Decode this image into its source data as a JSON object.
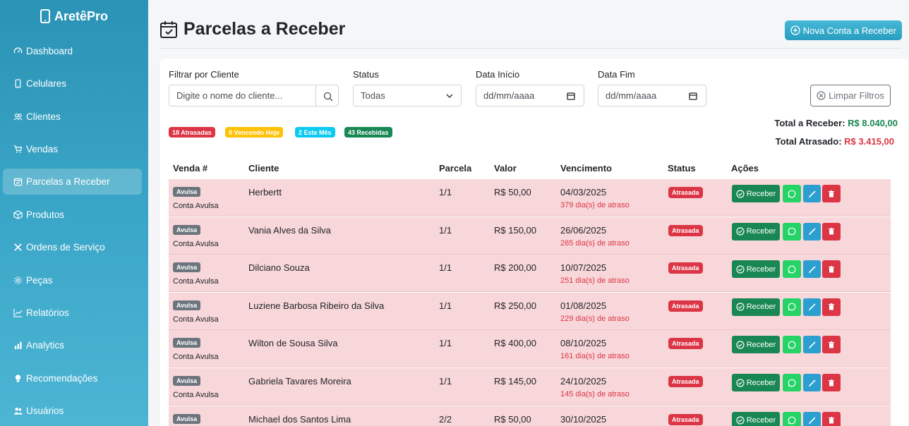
{
  "app": {
    "brand": "AretêPro"
  },
  "sidebar": {
    "items": [
      {
        "label": "Dashboard",
        "icon": "speedometer-icon"
      },
      {
        "label": "Celulares",
        "icon": "phone-icon"
      },
      {
        "label": "Clientes",
        "icon": "people-icon"
      },
      {
        "label": "Vendas",
        "icon": "cart-icon"
      },
      {
        "label": "Parcelas a Receber",
        "icon": "calendar-check-icon",
        "active": true
      },
      {
        "label": "Produtos",
        "icon": "box-icon"
      },
      {
        "label": "Ordens de Serviço",
        "icon": "tools-icon"
      },
      {
        "label": "Peças",
        "icon": "gear-icon"
      },
      {
        "label": "Relatórios",
        "icon": "graph-icon"
      },
      {
        "label": "Analytics",
        "icon": "bar-chart-icon"
      },
      {
        "label": "Recomendações",
        "icon": "lightbulb-icon"
      },
      {
        "label": "Usuários",
        "icon": "users-icon"
      }
    ]
  },
  "header": {
    "title": "Parcelas a Receber",
    "new_button": "Nova Conta a Receber"
  },
  "filters": {
    "client_label": "Filtrar por Cliente",
    "client_placeholder": "Digite o nome do cliente...",
    "status_label": "Status",
    "status_value": "Todas",
    "start_label": "Data Início",
    "start_value": "dd/mm/aaaa",
    "end_label": "Data Fim",
    "end_value": "dd/mm/aaaa",
    "clear_button": "Limpar Filtros"
  },
  "badges": [
    {
      "label": "18 Atrasadas",
      "color": "#dc3545"
    },
    {
      "label": "0 Vencendo Hoje",
      "color": "#ffc107"
    },
    {
      "label": "2 Este Mês",
      "color": "#0dcaf0"
    },
    {
      "label": "43 Recebidas",
      "color": "#198754"
    }
  ],
  "totals": {
    "receber_label": "Total a Receber:",
    "receber_value": "R$ 8.040,00",
    "atrasado_label": "Total Atrasado:",
    "atrasado_value": "R$ 3.415,00"
  },
  "table": {
    "headers": [
      "Venda #",
      "Cliente",
      "Parcela",
      "Valor",
      "Vencimento",
      "Status",
      "Ações"
    ],
    "receive_label": "Receber",
    "rows": [
      {
        "tag": "Avulsa",
        "type": "Conta Avulsa",
        "client": "Herbertt",
        "parcela": "1/1",
        "valor": "R$ 50,00",
        "vencimento": "04/03/2025",
        "atraso": "379 dia(s) de atraso",
        "status": "Atrasada"
      },
      {
        "tag": "Avulsa",
        "type": "Conta Avulsa",
        "client": "Vania Alves da Silva",
        "parcela": "1/1",
        "valor": "R$ 150,00",
        "vencimento": "26/06/2025",
        "atraso": "265 dia(s) de atraso",
        "status": "Atrasada"
      },
      {
        "tag": "Avulsa",
        "type": "Conta Avulsa",
        "client": "Dilciano Souza",
        "parcela": "1/1",
        "valor": "R$ 200,00",
        "vencimento": "10/07/2025",
        "atraso": "251 dia(s) de atraso",
        "status": "Atrasada"
      },
      {
        "tag": "Avulsa",
        "type": "Conta Avulsa",
        "client": "Luziene Barbosa Ribeiro da Silva",
        "parcela": "1/1",
        "valor": "R$ 250,00",
        "vencimento": "01/08/2025",
        "atraso": "229 dia(s) de atraso",
        "status": "Atrasada"
      },
      {
        "tag": "Avulsa",
        "type": "Conta Avulsa",
        "client": "Wilton de Sousa Silva",
        "parcela": "1/1",
        "valor": "R$ 400,00",
        "vencimento": "08/10/2025",
        "atraso": "161 dia(s) de atraso",
        "status": "Atrasada"
      },
      {
        "tag": "Avulsa",
        "type": "Conta Avulsa",
        "client": "Gabriela Tavares Moreira",
        "parcela": "1/1",
        "valor": "R$ 145,00",
        "vencimento": "24/10/2025",
        "atraso": "145 dia(s) de atraso",
        "status": "Atrasada"
      },
      {
        "tag": "Avulsa",
        "type": "",
        "client": "Michael dos Santos Lima",
        "parcela": "2/2",
        "valor": "R$ 50,00",
        "vencimento": "30/10/2025",
        "atraso": "",
        "status": "Atrasada"
      }
    ]
  }
}
